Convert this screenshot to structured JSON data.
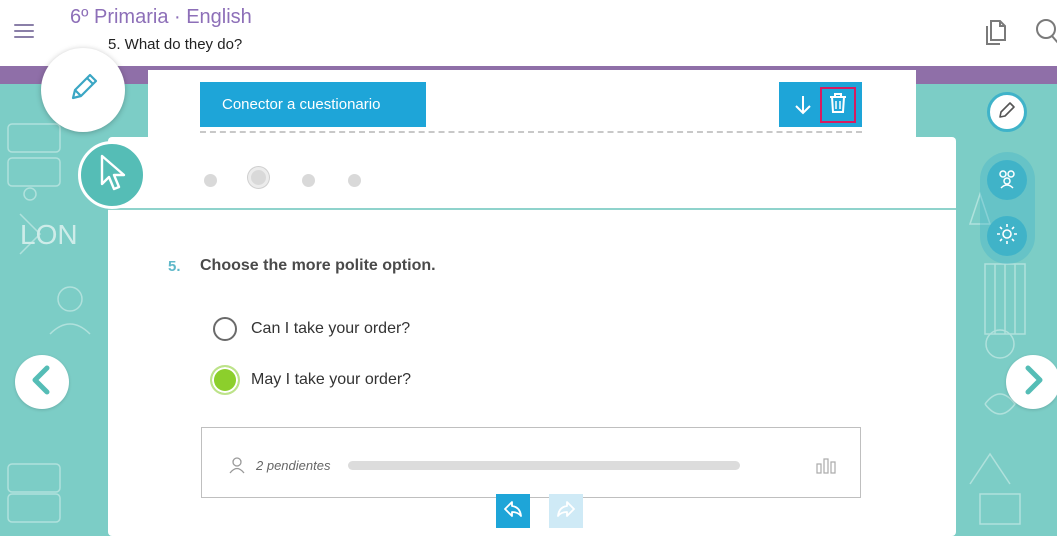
{
  "header": {
    "title": "6º Primaria · English",
    "subtitle": "5. What do they do?"
  },
  "toolbar": {
    "connector_label": "Conector a cuestionario"
  },
  "pager": {
    "dots": 4,
    "active_index": 1
  },
  "question": {
    "number": "5.",
    "text": "Choose the more polite option.",
    "options": [
      {
        "label": "Can I take your order?",
        "selected": false
      },
      {
        "label": "May I take your order?",
        "selected": true
      }
    ]
  },
  "progress": {
    "pending_label": "2 pendientes",
    "fraction": 0.0
  },
  "colors": {
    "accent_blue": "#1ea5d8",
    "brand_purple": "#8f6fa8",
    "teal_bg": "#7ccdc6",
    "selected_green": "#8ccf2c",
    "delete_highlight": "#d81b60"
  },
  "icons": {
    "menu": "hamburger-icon",
    "top_right_1": "copy-pages-icon",
    "top_right_2": "search-icon",
    "pencil": "pencil-icon",
    "cursor": "pointer-cursor-icon",
    "download": "arrow-down-icon",
    "delete": "trash-icon",
    "pending": "user-icon",
    "stats": "bar-chart-icon",
    "undo": "undo-icon",
    "redo": "redo-icon",
    "prev": "chevron-left-icon",
    "next": "chevron-right-icon",
    "right_pen": "pencil-icon",
    "right_users": "users-icon",
    "right_settings": "gear-icon"
  }
}
